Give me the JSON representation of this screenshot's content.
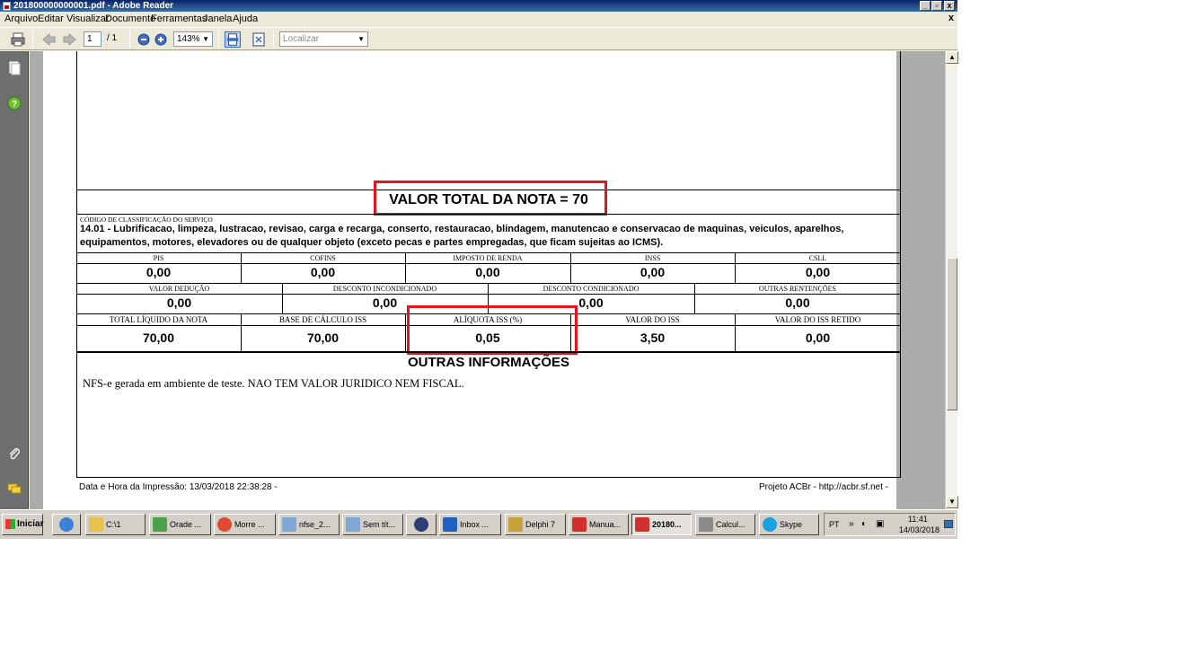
{
  "window": {
    "title": "201800000000001.pdf - Adobe Reader",
    "minimize": "_",
    "restore": "▫",
    "close": "x",
    "doc_close": "x"
  },
  "menu": [
    "Arquivo",
    "Editar",
    "Visualizar",
    "Documento",
    "Ferramentas",
    "Janela",
    "Ajuda"
  ],
  "toolbar": {
    "page_current": "1",
    "page_total": "/ 1",
    "zoom": "143%",
    "search_placeholder": "Localizar"
  },
  "document": {
    "valor_total": "VALOR TOTAL DA NOTA = 70",
    "classificacao_label": "CÓDIGO DE CLASSIFICAÇÃO DO SERVIÇO",
    "classificacao_text": "14.01 - Lubrificacao, limpeza, lustracao, revisao, carga e recarga, conserto, restauracao, blindagem, manutencao e conservacao de maquinas, veiculos, aparelhos, equipamentos, motores, elevadores ou de qualquer objeto (exceto pecas e partes empregadas, que ficam sujeitas ao ICMS).",
    "row1": [
      {
        "label": "PIS",
        "value": "0,00"
      },
      {
        "label": "COFINS",
        "value": "0,00"
      },
      {
        "label": "IMPOSTO DE RENDA",
        "value": "0,00"
      },
      {
        "label": "INSS",
        "value": "0,00"
      },
      {
        "label": "CSLL",
        "value": "0,00"
      }
    ],
    "row2": [
      {
        "label": "VALOR DEDUÇÃO",
        "value": "0,00"
      },
      {
        "label": "DESCONTO INCONDICIONADO",
        "value": "0,00"
      },
      {
        "label": "DESCONTO CONDICIONADO",
        "value": "0,00"
      },
      {
        "label": "OUTRAS RENTENÇÕES",
        "value": "0,00"
      }
    ],
    "row3": [
      {
        "label": "TOTAL LÍQUIDO DA NOTA",
        "value": "70,00"
      },
      {
        "label": "BASE DE CÁLCULO ISS",
        "value": "70,00"
      },
      {
        "label": "ALÍQUOTA ISS (%)",
        "value": "0,05"
      },
      {
        "label": "VALOR DO ISS",
        "value": "3,50"
      },
      {
        "label": "VALOR DO ISS RETIDO",
        "value": "0,00"
      }
    ],
    "outras_title": "OUTRAS INFORMAÇÕES",
    "outras_text": "NFS-e gerada em ambiente de teste. NAO TEM VALOR JURIDICO NEM FISCAL.",
    "footer_left": "Data e Hora da Impressão: 13/03/2018  22:38:28 -",
    "footer_right": "Projeto ACBr - http://acbr.sf.net -"
  },
  "taskbar": {
    "start": "Iniciar",
    "tasks": [
      {
        "label": "",
        "icon": "internet-explorer-icon",
        "color": "#3b82d6"
      },
      {
        "label": "C:\\1",
        "icon": "folder-icon",
        "color": "#e8c24a"
      },
      {
        "label": "Orade ...",
        "icon": "oracle-icon",
        "color": "#4aa34a"
      },
      {
        "label": "Morre ...",
        "icon": "chrome-icon",
        "color": "#e24a33"
      },
      {
        "label": "nfse_2...",
        "icon": "notepad-icon",
        "color": "#7fa8d8"
      },
      {
        "label": "Sem tít...",
        "icon": "notepad-icon",
        "color": "#7fa8d8"
      },
      {
        "label": "",
        "icon": "globe-icon",
        "color": "#2c3e75"
      },
      {
        "label": "Inbox ...",
        "icon": "outlook-icon",
        "color": "#1f5fbf"
      },
      {
        "label": "Delphi 7",
        "icon": "delphi-icon",
        "color": "#c8a03a"
      },
      {
        "label": "Manua...",
        "icon": "pdf-icon",
        "color": "#d0312d"
      },
      {
        "label": "20180...",
        "icon": "pdf-icon",
        "color": "#d0312d"
      },
      {
        "label": "Calcul...",
        "icon": "calculator-icon",
        "color": "#8a8a8a"
      },
      {
        "label": "Skype",
        "icon": "skype-icon",
        "color": "#1ba0e1"
      }
    ],
    "lang": "PT",
    "time": "11:41",
    "date": "14/03/2018"
  }
}
